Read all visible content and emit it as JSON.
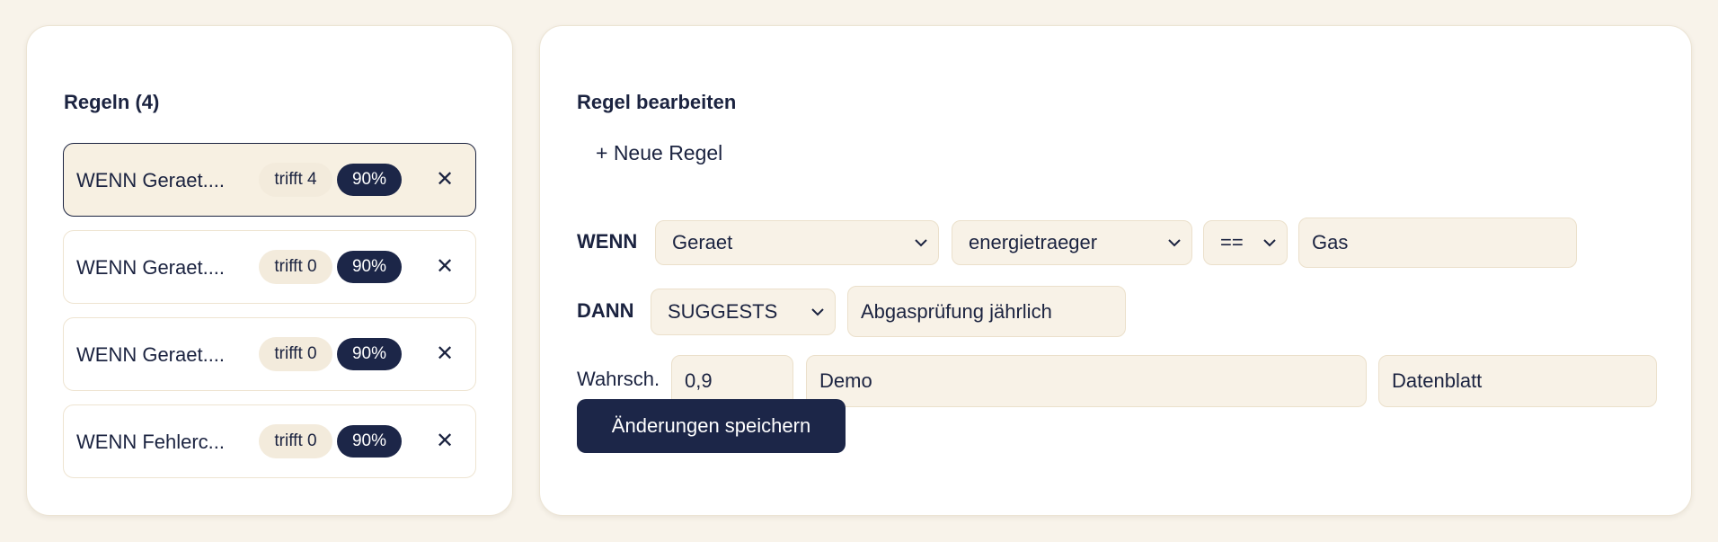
{
  "rules_panel": {
    "title": "Regeln (4)",
    "rules": [
      {
        "text": "WENN Geraet....",
        "hits": "trifft 4",
        "prob": "90%",
        "active": true
      },
      {
        "text": "WENN Geraet....",
        "hits": "trifft 0",
        "prob": "90%",
        "active": false
      },
      {
        "text": "WENN Geraet....",
        "hits": "trifft 0",
        "prob": "90%",
        "active": false
      },
      {
        "text": "WENN Fehlerc...",
        "hits": "trifft 0",
        "prob": "90%",
        "active": false
      }
    ],
    "close_glyph": "✕"
  },
  "editor": {
    "title": "Regel bearbeiten",
    "new_rule_label": "+ Neue Regel",
    "if_label": "WENN",
    "then_label": "DANN",
    "if_entity": "Geraet",
    "if_attribute": "energietraeger",
    "if_operator": "==",
    "if_value": "Gas",
    "then_action": "SUGGESTS",
    "then_value": "Abgasprüfung jährlich",
    "prob_label": "Wahrsch.",
    "prob_value": "0,9",
    "source_value": "Demo",
    "reference_value": "Datenblatt",
    "save_label": "Änderungen speichern"
  },
  "colors": {
    "background": "#f8f3ea",
    "accent": "#1c2648",
    "field": "#f8f2e7"
  }
}
